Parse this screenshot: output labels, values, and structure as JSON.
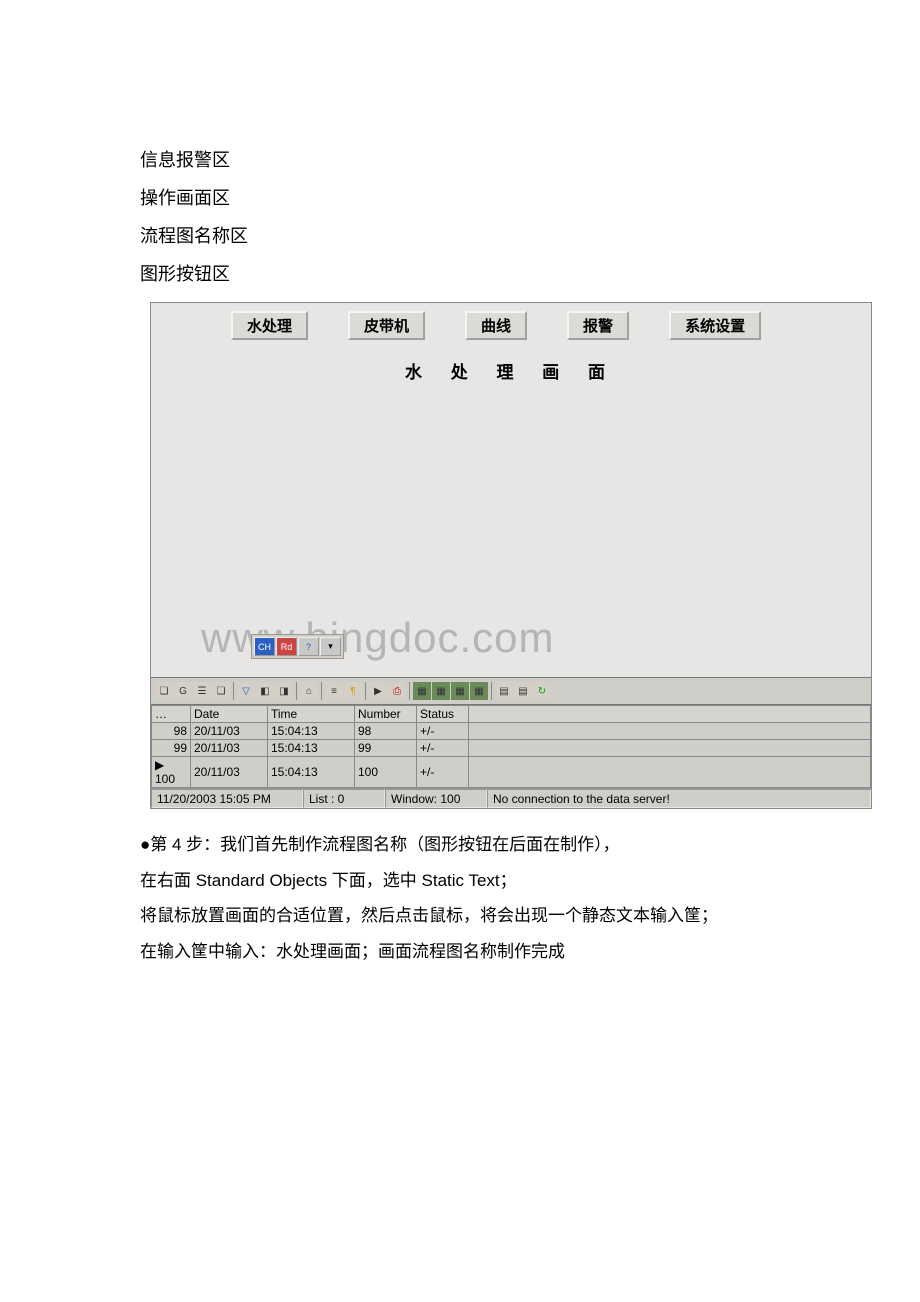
{
  "header_lines": {
    "l1": "信息报警区",
    "l2": "操作画面区",
    "l3": "流程图名称区",
    "l4": "图形按钮区"
  },
  "nav": {
    "b1": "水处理",
    "b2": "皮带机",
    "b3": "曲线",
    "b4": "报警",
    "b5": "系统设置"
  },
  "subtitle": "水 处 理 画 面",
  "watermark": "www.bingdoc.com",
  "tray_icons": {
    "i1": "CH",
    "i2": "Rd",
    "i3": "?",
    "i4": "▾"
  },
  "toolbar2": {
    "names": [
      "glyph",
      "G",
      "bars",
      "page",
      "funnel",
      "flag1",
      "flag2",
      "disk",
      "list",
      "pipe",
      "play",
      "print",
      "win1",
      "win2",
      "win3",
      "win4",
      "doc1",
      "doc2",
      "refresh"
    ]
  },
  "grid": {
    "headers": {
      "marker": "…",
      "date": "Date",
      "time": "Time",
      "number": "Number",
      "status": "Status"
    },
    "rows": [
      {
        "marker": "",
        "idx": "98",
        "date": "20/11/03",
        "time": "15:04:13",
        "number": "98",
        "status": "+/-"
      },
      {
        "marker": "",
        "idx": "99",
        "date": "20/11/03",
        "time": "15:04:13",
        "number": "99",
        "status": "+/-"
      },
      {
        "marker": "▶",
        "idx": "100",
        "date": "20/11/03",
        "time": "15:04:13",
        "number": "100",
        "status": "+/-"
      }
    ]
  },
  "statusbar": {
    "datetime": "11/20/2003 15:05 PM",
    "list": "List : 0",
    "window": "Window: 100",
    "conn": "No connection to the data server!"
  },
  "footer": {
    "p1": "●第 4 步：我们首先制作流程图名称（图形按钮在后面在制作），",
    "p2": "在右面 Standard Objects 下面，选中 Static Text；",
    "p3": "将鼠标放置画面的合适位置，然后点击鼠标，将会出现一个静态文本输入筐；",
    "p4": "在输入筐中输入：水处理画面；画面流程图名称制作完成"
  }
}
